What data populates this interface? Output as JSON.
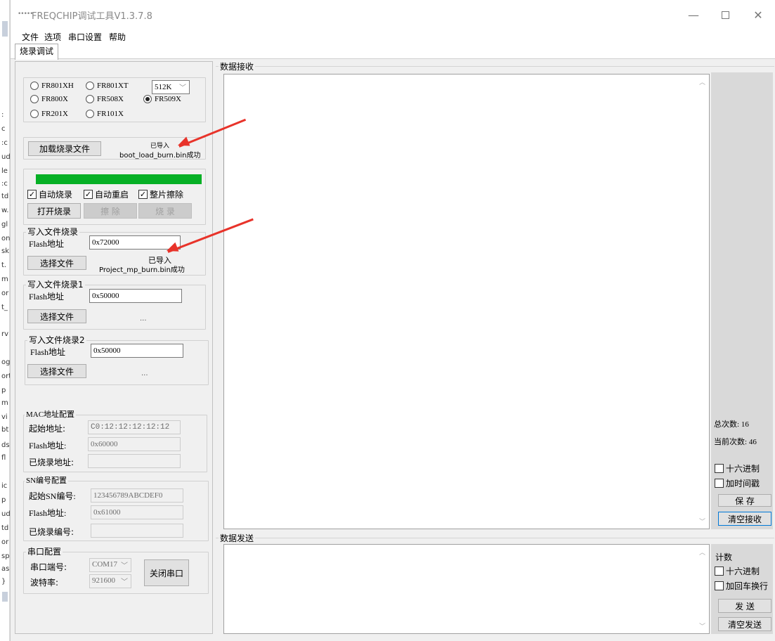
{
  "window": {
    "title": "FREQCHIP调试工具V1.3.7.8"
  },
  "menu": [
    "文件",
    "选项",
    "串口设置",
    "帮助"
  ],
  "tab": "烧录调试",
  "chips": {
    "options": [
      "FR801XH",
      "FR801XT",
      "FR800X",
      "FR508X",
      "FR509X",
      "FR201X",
      "FR101X"
    ],
    "selected": "FR509X",
    "size": "512K"
  },
  "load": {
    "button": "加载烧录文件",
    "status_line1": "已导入",
    "status_line2": "boot_load_burn.bin成功"
  },
  "burn": {
    "progress": 1.0,
    "auto_burn": "自动烧录",
    "auto_restart": "自动重启",
    "chip_erase": "整片擦除",
    "open_burn": "打开烧录",
    "erase": "擦 除",
    "burn": "烧 录"
  },
  "write0": {
    "title": "写入文件烧录",
    "flash_label": "Flash地址",
    "flash_value": "0x72000",
    "select": "选择文件",
    "status_line1": "已导入",
    "status_line2": "Project_mp_burn.bin成功"
  },
  "write1": {
    "title": "写入文件烧录1",
    "flash_label": "Flash地址",
    "flash_value": "0x50000",
    "select": "选择文件",
    "status": "..."
  },
  "write2": {
    "title": "写入文件烧录2",
    "flash_label": "Flash地址",
    "flash_value": "0x50000",
    "select": "选择文件",
    "status": "..."
  },
  "mac": {
    "title": "MAC地址配置",
    "start_label": "起始地址:",
    "start_value": "C0:12:12:12:12:12",
    "flash_label": "Flash地址:",
    "flash_value": "0x60000",
    "burned_label": "已烧录地址:",
    "burned_value": ""
  },
  "sn": {
    "title": "SN编号配置",
    "start_label": "起始SN编号:",
    "start_value": "123456789ABCDEF0",
    "flash_label": "Flash地址:",
    "flash_value": "0x61000",
    "burned_label": "已烧录编号:",
    "burned_value": ""
  },
  "serial": {
    "title": "串口配置",
    "port_label": "串口端号:",
    "port_value": "COM17",
    "baud_label": "波特率:",
    "baud_value": "921600",
    "close": "关闭串口"
  },
  "receive": {
    "title": "数据接收",
    "total_label": "总次数:",
    "total_value": "16",
    "current_label": "当前次数:",
    "current_value": "46",
    "hex": "十六进制",
    "timestamp": "加时间戳",
    "save": "保 存",
    "clear": "清空接收"
  },
  "send": {
    "title": "数据发送",
    "count": "计数",
    "hex": "十六进制",
    "crlf": "加回车换行",
    "send": "发 送",
    "clear": "清空发送"
  },
  "bg_window_fragments": [
    ":",
    "c",
    ":c",
    "ud",
    "le",
    ":c",
    "td",
    "w.",
    "gl",
    "on",
    "sk",
    "t.",
    "m",
    "or",
    "t_",
    "rv",
    "og",
    "ort",
    "p",
    "m",
    "vi",
    "bt",
    "ds",
    "fl",
    "ic",
    "p",
    "ud",
    "td",
    "or",
    "sp",
    "as",
    "}"
  ],
  "colors": {
    "progress": "#06b025",
    "annotation_arrow": "#e8332a",
    "focus": "#0078d7"
  }
}
